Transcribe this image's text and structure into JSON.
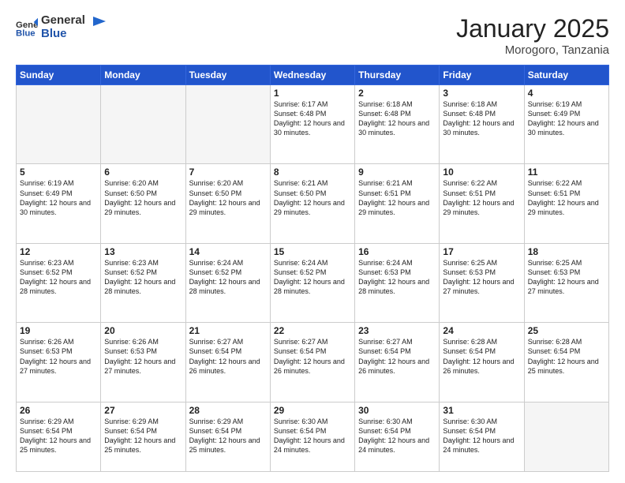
{
  "header": {
    "logo_general": "General",
    "logo_blue": "Blue",
    "month": "January 2025",
    "location": "Morogoro, Tanzania"
  },
  "days_of_week": [
    "Sunday",
    "Monday",
    "Tuesday",
    "Wednesday",
    "Thursday",
    "Friday",
    "Saturday"
  ],
  "weeks": [
    [
      {
        "day": "",
        "info": ""
      },
      {
        "day": "",
        "info": ""
      },
      {
        "day": "",
        "info": ""
      },
      {
        "day": "1",
        "info": "Sunrise: 6:17 AM\nSunset: 6:48 PM\nDaylight: 12 hours\nand 30 minutes."
      },
      {
        "day": "2",
        "info": "Sunrise: 6:18 AM\nSunset: 6:48 PM\nDaylight: 12 hours\nand 30 minutes."
      },
      {
        "day": "3",
        "info": "Sunrise: 6:18 AM\nSunset: 6:48 PM\nDaylight: 12 hours\nand 30 minutes."
      },
      {
        "day": "4",
        "info": "Sunrise: 6:19 AM\nSunset: 6:49 PM\nDaylight: 12 hours\nand 30 minutes."
      }
    ],
    [
      {
        "day": "5",
        "info": "Sunrise: 6:19 AM\nSunset: 6:49 PM\nDaylight: 12 hours\nand 30 minutes."
      },
      {
        "day": "6",
        "info": "Sunrise: 6:20 AM\nSunset: 6:50 PM\nDaylight: 12 hours\nand 29 minutes."
      },
      {
        "day": "7",
        "info": "Sunrise: 6:20 AM\nSunset: 6:50 PM\nDaylight: 12 hours\nand 29 minutes."
      },
      {
        "day": "8",
        "info": "Sunrise: 6:21 AM\nSunset: 6:50 PM\nDaylight: 12 hours\nand 29 minutes."
      },
      {
        "day": "9",
        "info": "Sunrise: 6:21 AM\nSunset: 6:51 PM\nDaylight: 12 hours\nand 29 minutes."
      },
      {
        "day": "10",
        "info": "Sunrise: 6:22 AM\nSunset: 6:51 PM\nDaylight: 12 hours\nand 29 minutes."
      },
      {
        "day": "11",
        "info": "Sunrise: 6:22 AM\nSunset: 6:51 PM\nDaylight: 12 hours\nand 29 minutes."
      }
    ],
    [
      {
        "day": "12",
        "info": "Sunrise: 6:23 AM\nSunset: 6:52 PM\nDaylight: 12 hours\nand 28 minutes."
      },
      {
        "day": "13",
        "info": "Sunrise: 6:23 AM\nSunset: 6:52 PM\nDaylight: 12 hours\nand 28 minutes."
      },
      {
        "day": "14",
        "info": "Sunrise: 6:24 AM\nSunset: 6:52 PM\nDaylight: 12 hours\nand 28 minutes."
      },
      {
        "day": "15",
        "info": "Sunrise: 6:24 AM\nSunset: 6:52 PM\nDaylight: 12 hours\nand 28 minutes."
      },
      {
        "day": "16",
        "info": "Sunrise: 6:24 AM\nSunset: 6:53 PM\nDaylight: 12 hours\nand 28 minutes."
      },
      {
        "day": "17",
        "info": "Sunrise: 6:25 AM\nSunset: 6:53 PM\nDaylight: 12 hours\nand 27 minutes."
      },
      {
        "day": "18",
        "info": "Sunrise: 6:25 AM\nSunset: 6:53 PM\nDaylight: 12 hours\nand 27 minutes."
      }
    ],
    [
      {
        "day": "19",
        "info": "Sunrise: 6:26 AM\nSunset: 6:53 PM\nDaylight: 12 hours\nand 27 minutes."
      },
      {
        "day": "20",
        "info": "Sunrise: 6:26 AM\nSunset: 6:53 PM\nDaylight: 12 hours\nand 27 minutes."
      },
      {
        "day": "21",
        "info": "Sunrise: 6:27 AM\nSunset: 6:54 PM\nDaylight: 12 hours\nand 26 minutes."
      },
      {
        "day": "22",
        "info": "Sunrise: 6:27 AM\nSunset: 6:54 PM\nDaylight: 12 hours\nand 26 minutes."
      },
      {
        "day": "23",
        "info": "Sunrise: 6:27 AM\nSunset: 6:54 PM\nDaylight: 12 hours\nand 26 minutes."
      },
      {
        "day": "24",
        "info": "Sunrise: 6:28 AM\nSunset: 6:54 PM\nDaylight: 12 hours\nand 26 minutes."
      },
      {
        "day": "25",
        "info": "Sunrise: 6:28 AM\nSunset: 6:54 PM\nDaylight: 12 hours\nand 25 minutes."
      }
    ],
    [
      {
        "day": "26",
        "info": "Sunrise: 6:29 AM\nSunset: 6:54 PM\nDaylight: 12 hours\nand 25 minutes."
      },
      {
        "day": "27",
        "info": "Sunrise: 6:29 AM\nSunset: 6:54 PM\nDaylight: 12 hours\nand 25 minutes."
      },
      {
        "day": "28",
        "info": "Sunrise: 6:29 AM\nSunset: 6:54 PM\nDaylight: 12 hours\nand 25 minutes."
      },
      {
        "day": "29",
        "info": "Sunrise: 6:30 AM\nSunset: 6:54 PM\nDaylight: 12 hours\nand 24 minutes."
      },
      {
        "day": "30",
        "info": "Sunrise: 6:30 AM\nSunset: 6:54 PM\nDaylight: 12 hours\nand 24 minutes."
      },
      {
        "day": "31",
        "info": "Sunrise: 6:30 AM\nSunset: 6:54 PM\nDaylight: 12 hours\nand 24 minutes."
      },
      {
        "day": "",
        "info": ""
      }
    ]
  ]
}
